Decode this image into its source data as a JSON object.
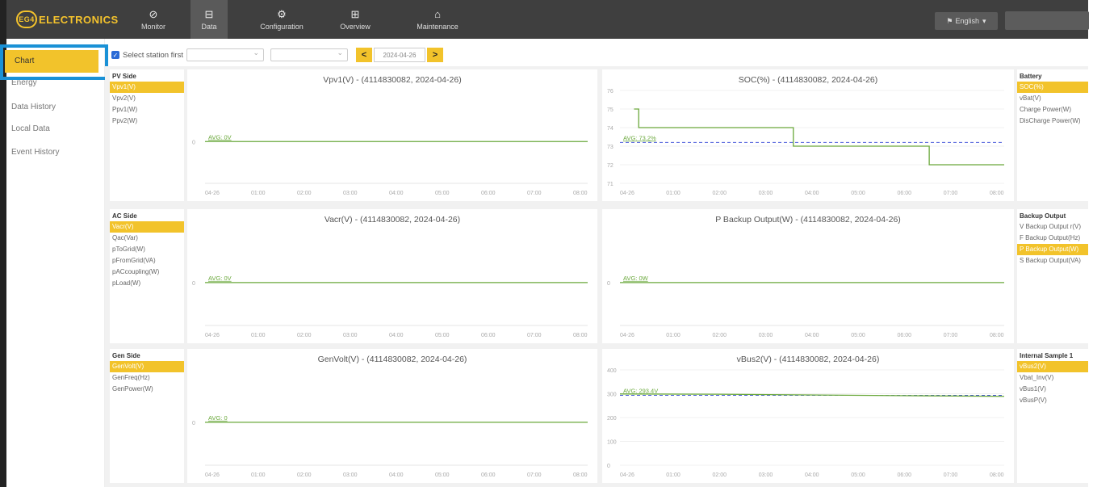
{
  "brand": {
    "badge": "EG4",
    "name": "ELECTRONICS"
  },
  "nav": [
    {
      "label": "Monitor",
      "icon": "⊘"
    },
    {
      "label": "Data",
      "icon": "⊟"
    },
    {
      "label": "Configuration",
      "icon": "⚙"
    },
    {
      "label": "Overview",
      "icon": "⊞"
    },
    {
      "label": "Maintenance",
      "icon": "⌂"
    }
  ],
  "language": "English",
  "sidebar": [
    "Chart",
    "Energy",
    "Data History",
    "Local Data",
    "Event History"
  ],
  "toolbar": {
    "select_station": "Select station first",
    "date": "2024-04-26",
    "prev": "<",
    "next": ">"
  },
  "panels": {
    "pv": {
      "title": "PV Side",
      "items": [
        "Vpv1(V)",
        "Vpv2(V)",
        "Ppv1(W)",
        "Ppv2(W)"
      ]
    },
    "ac": {
      "title": "AC Side",
      "items": [
        "Vacr(V)",
        "Qac(Var)",
        "pToGrid(W)",
        "pFromGrid(VA)",
        "pACcoupling(W)",
        "pLoad(W)"
      ]
    },
    "gen": {
      "title": "Gen Side",
      "items": [
        "GenVolt(V)",
        "GenFreq(Hz)",
        "GenPower(W)"
      ]
    },
    "battery": {
      "title": "Battery",
      "items": [
        "SOC(%)",
        "vBat(V)",
        "Charge Power(W)",
        "DisCharge Power(W)"
      ]
    },
    "backup": {
      "title": "Backup Output",
      "items": [
        "V Backup Output r(V)",
        "F Backup Output(Hz)",
        "P Backup Output(W)",
        "S Backup Output(VA)"
      ]
    },
    "internal": {
      "title": "Internal Sample 1",
      "items": [
        "vBus2(V)",
        "Vbat_Inv(V)",
        "vBus1(V)",
        "vBusP(V)"
      ]
    }
  },
  "chart_data": [
    {
      "type": "line",
      "title": "Vpv1(V) - (4114830082, 2024-04-26)",
      "x": [
        "04-26",
        "01:00",
        "02:00",
        "03:00",
        "04:00",
        "05:00",
        "06:00",
        "07:00",
        "08:00"
      ],
      "yticks": [
        "0"
      ],
      "ylim": [
        0,
        1
      ],
      "avg_label": "AVG: 0V",
      "avg": 0,
      "series": [
        {
          "values": [
            [
              0,
              0
            ],
            [
              8.2,
              0
            ]
          ]
        }
      ]
    },
    {
      "type": "line",
      "title": "SOC(%) - (4114830082, 2024-04-26)",
      "x": [
        "04-26",
        "01:00",
        "02:00",
        "03:00",
        "04:00",
        "05:00",
        "06:00",
        "07:00",
        "08:00"
      ],
      "yticks": [
        "71",
        "72",
        "73",
        "74",
        "75",
        "76"
      ],
      "ylim": [
        71,
        76
      ],
      "avg_label": "AVG: 73.2%",
      "avg": 73.2,
      "series": [
        {
          "values": [
            [
              0.3,
              75
            ],
            [
              0.4,
              75
            ],
            [
              0.4,
              74
            ],
            [
              3.7,
              74
            ],
            [
              3.7,
              73
            ],
            [
              6.6,
              73
            ],
            [
              6.6,
              72
            ],
            [
              8.2,
              72
            ]
          ]
        }
      ]
    },
    {
      "type": "line",
      "title": "Vacr(V) - (4114830082, 2024-04-26)",
      "x": [
        "04-26",
        "01:00",
        "02:00",
        "03:00",
        "04:00",
        "05:00",
        "06:00",
        "07:00",
        "08:00"
      ],
      "yticks": [
        "0"
      ],
      "ylim": [
        0,
        1
      ],
      "avg_label": "AVG: 0V",
      "avg": 0,
      "series": [
        {
          "values": [
            [
              0,
              0
            ],
            [
              8.2,
              0
            ]
          ]
        }
      ]
    },
    {
      "type": "line",
      "title": "P Backup Output(W) - (4114830082, 2024-04-26)",
      "x": [
        "04-26",
        "01:00",
        "02:00",
        "03:00",
        "04:00",
        "05:00",
        "06:00",
        "07:00",
        "08:00"
      ],
      "yticks": [
        "0"
      ],
      "ylim": [
        0,
        1
      ],
      "avg_label": "AVG: 0W",
      "avg": 0,
      "series": [
        {
          "values": [
            [
              0,
              0
            ],
            [
              8.2,
              0
            ]
          ]
        }
      ]
    },
    {
      "type": "line",
      "title": "GenVolt(V) - (4114830082, 2024-04-26)",
      "x": [
        "04-26",
        "01:00",
        "02:00",
        "03:00",
        "04:00",
        "05:00",
        "06:00",
        "07:00",
        "08:00"
      ],
      "yticks": [
        "0"
      ],
      "ylim": [
        0,
        1
      ],
      "avg_label": "AVG: 0",
      "avg": 0,
      "series": [
        {
          "values": [
            [
              0,
              0
            ],
            [
              8.2,
              0
            ]
          ]
        }
      ]
    },
    {
      "type": "line",
      "title": "vBus2(V) - (4114830082, 2024-04-26)",
      "x": [
        "04-26",
        "01:00",
        "02:00",
        "03:00",
        "04:00",
        "05:00",
        "06:00",
        "07:00",
        "08:00"
      ],
      "yticks": [
        "0",
        "100",
        "200",
        "300",
        "400"
      ],
      "ylim": [
        0,
        400
      ],
      "avg_label": "AVG: 293.4V",
      "avg": 293.4,
      "series": [
        {
          "values": [
            [
              0,
              299
            ],
            [
              2,
              298
            ],
            [
              4,
              295
            ],
            [
              6,
              292
            ],
            [
              8.2,
              289
            ]
          ]
        }
      ]
    }
  ],
  "colors": {
    "accent": "#f2c32b",
    "line": "#6aa83b",
    "avg": "#4a5bdc",
    "nav_bg": "#3f3f3f"
  }
}
